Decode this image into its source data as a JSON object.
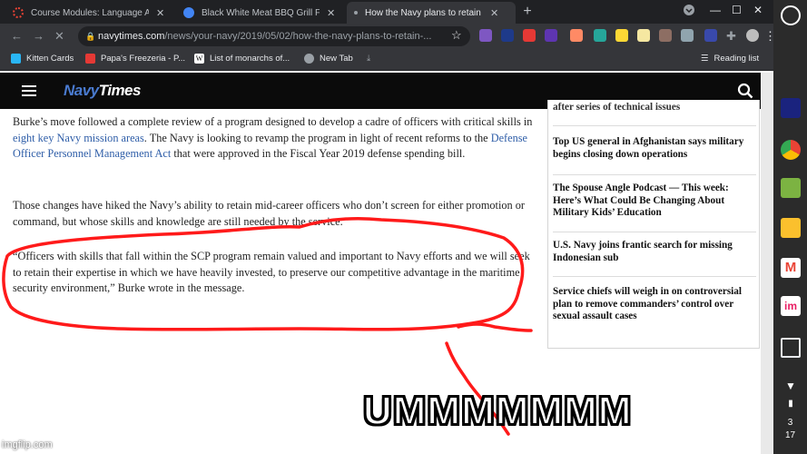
{
  "browser": {
    "tabs": [
      {
        "title": "Course Modules: Language Arts",
        "favicon_color": "#ea4335",
        "active": false
      },
      {
        "title": "Black White Meat BBQ Grill Food",
        "favicon_color": "#4285f4",
        "active": false
      },
      {
        "title": "How the Navy plans to retain officers",
        "favicon_color": "#9aa0a6",
        "active": true
      }
    ],
    "new_tab_symbol": "+",
    "url_host": "navytimes.com",
    "url_path": "/news/your-navy/2019/05/02/how-the-navy-plans-to-retain-...",
    "bookmarks": [
      "Kitten Cards",
      "Papa's Freezeria - P...",
      "List of monarchs of...",
      "New Tab"
    ],
    "reading_list": "Reading list"
  },
  "site": {
    "logo_navy": "Navy",
    "logo_times": "Times"
  },
  "article": {
    "p1_a": "Burke’s move followed a complete review of a program designed to develop a cadre of officers with critical skills in ",
    "p1_link1": "eight key Navy mission areas",
    "p1_b": ". The Navy is looking to revamp the program in light of recent reforms to the ",
    "p1_link2": "Defense Officer Personnel Management Act",
    "p1_c": " that were approved in the Fiscal Year 2019 defense spending bill.",
    "p2": "Those changes have hiked the Navy’s ability to retain mid-career officers who don’t screen for either promotion or command, but whose skills and knowledge are still needed by the service.",
    "p3": "“Officers with skills that fall within the SCP program remain valued and important to Navy efforts and we will seek to retain their expertise in which we have heavily invested, to preserve our competitive advantage in the maritime security environment,” Burke wrote in the message."
  },
  "sidebar": {
    "items": [
      "after series of technical issues",
      "Top US general in Afghanistan says military begins closing down operations",
      "The Spouse Angle Podcast — This week: Here’s What Could Be Changing About Military Kids’ Education",
      "U.S. Navy joins frantic search for missing Indonesian sub",
      "Service chiefs will weigh in on controversial plan to remove commanders’ control over sexual assault cases"
    ]
  },
  "overlay": {
    "meme_caption": "UMMMMMMM",
    "watermark": "imgflip.com",
    "scribble_color": "#ff1a1a"
  },
  "shelf": {
    "time_hour": "3",
    "time_min": "17"
  }
}
